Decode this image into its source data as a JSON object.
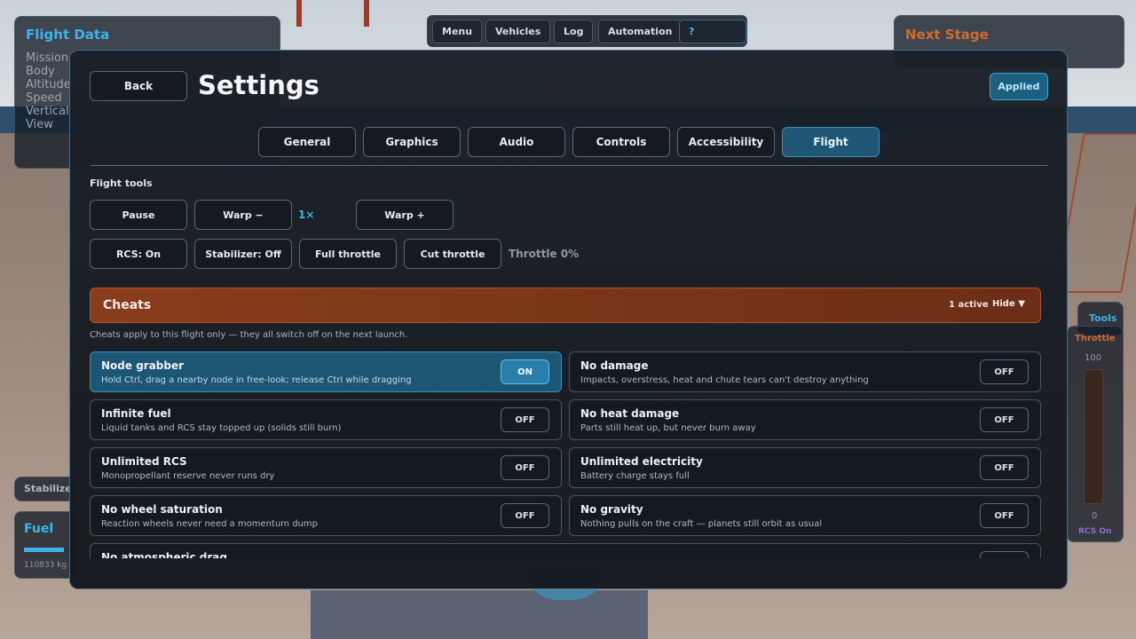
{
  "background": {
    "flight_data": {
      "title": "Flight Data",
      "rows": [
        "Mission",
        "Body",
        "Altitude",
        "Speed",
        "Vertical",
        "View"
      ]
    },
    "next_stage": {
      "title": "Next Stage"
    },
    "top_nav": [
      "Menu",
      "Vehicles",
      "Log",
      "Automation",
      "? Controls"
    ],
    "stabilizer": "Stabilizer",
    "fuel": {
      "title": "Fuel",
      "mass": "110833 kg",
      "level": 0.75
    },
    "tools": "Tools",
    "throttle": {
      "title": "Throttle",
      "max": "100",
      "min": "0",
      "rcs": "RCS On"
    }
  },
  "settings": {
    "back_label": "Back",
    "title": "Settings",
    "applied_label": "Applied",
    "tabs": [
      "General",
      "Graphics",
      "Audio",
      "Controls",
      "Accessibility",
      "Flight"
    ],
    "active_tab": "Flight",
    "flight_tools": {
      "label": "Flight tools",
      "pause": "Pause",
      "warp_down": "Warp −",
      "warp_mult": "1×",
      "warp_up": "Warp +",
      "rcs": "RCS: On",
      "stabilizer": "Stabilizer: Off",
      "full_throttle": "Full throttle",
      "cut_throttle": "Cut throttle",
      "throttle_readout": "Throttle 0%"
    },
    "cheats": {
      "title": "Cheats",
      "active_count": "1 active",
      "hide_label": "Hide ▼",
      "note": "Cheats apply to this flight only — they all switch off on the next launch.",
      "items": [
        {
          "name": "Node grabber",
          "desc": "Hold Ctrl, drag a nearby node in free-look; release Ctrl while dragging",
          "state": "ON"
        },
        {
          "name": "No damage",
          "desc": "Impacts, overstress, heat and chute tears can't destroy anything",
          "state": "OFF"
        },
        {
          "name": "Infinite fuel",
          "desc": "Liquid tanks and RCS stay topped up (solids still burn)",
          "state": "OFF"
        },
        {
          "name": "No heat damage",
          "desc": "Parts still heat up, but never burn away",
          "state": "OFF"
        },
        {
          "name": "Unlimited RCS",
          "desc": "Monopropellant reserve never runs dry",
          "state": "OFF"
        },
        {
          "name": "Unlimited electricity",
          "desc": "Battery charge stays full",
          "state": "OFF"
        },
        {
          "name": "No wheel saturation",
          "desc": "Reaction wheels never need a momentum dump",
          "state": "OFF"
        },
        {
          "name": "No gravity",
          "desc": "Nothing pulls on the craft — planets still orbit as usual",
          "state": "OFF"
        },
        {
          "name": "No atmospheric drag",
          "desc": "",
          "state": "OFF"
        }
      ]
    }
  }
}
